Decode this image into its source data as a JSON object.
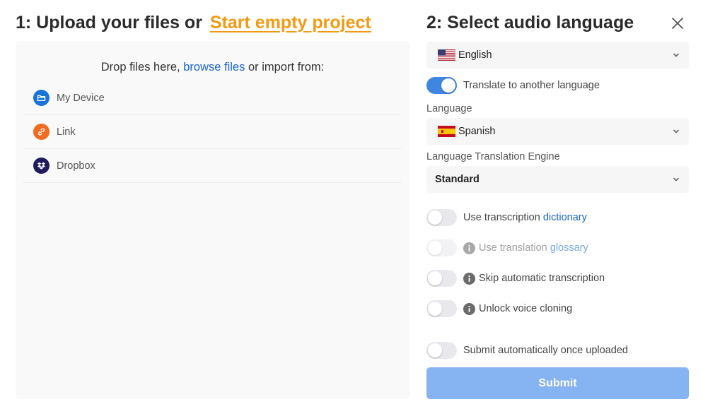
{
  "upload": {
    "title_prefix": "1: Upload your files or",
    "start_empty_label": "Start empty project",
    "drop_text_before": "Drop files here,",
    "browse_label": "browse files",
    "drop_text_after": "or import from:",
    "sources": [
      {
        "label": "My Device",
        "icon": "folder-icon",
        "color": "#1a73d9"
      },
      {
        "label": "Link",
        "icon": "link-icon",
        "color": "#f26b21"
      },
      {
        "label": "Dropbox",
        "icon": "dropbox-icon",
        "color": "#1f1b5e"
      }
    ]
  },
  "language": {
    "title": "2: Select audio language",
    "close_icon": "close-icon",
    "audio_language": "English",
    "translate_toggle": {
      "label": "Translate to another language",
      "on": true
    },
    "target_language_label": "Language",
    "target_language": "Spanish",
    "engine_label": "Language Translation Engine",
    "engine_value": "Standard",
    "dictionary_toggle": {
      "label_before": "Use transcription",
      "link": "dictionary",
      "on": false
    },
    "glossary_toggle": {
      "label_before": "Use translation",
      "link": "glossary",
      "on": false,
      "disabled": true
    },
    "skip_toggle": {
      "label": "Skip automatic transcription",
      "on": false
    },
    "voice_toggle": {
      "label": "Unlock voice cloning",
      "on": false
    },
    "auto_submit_toggle": {
      "label": "Submit automatically once uploaded",
      "on": false
    },
    "submit_label": "Submit"
  },
  "colors": {
    "accent": "#f29a12",
    "link": "#1a66cc",
    "toggle_on": "#3f86e0",
    "submit_disabled": "#86b3f2"
  }
}
